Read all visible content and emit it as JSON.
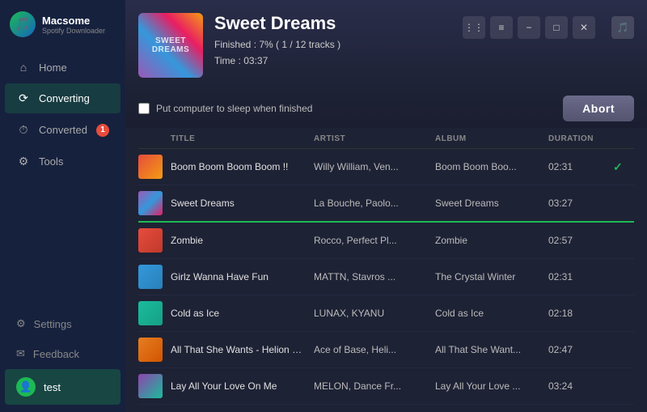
{
  "app": {
    "name": "Macsome",
    "subtitle": "Spotify Downloader",
    "logo_symbol": "🎵"
  },
  "sidebar": {
    "nav_items": [
      {
        "id": "home",
        "label": "Home",
        "icon": "⌂",
        "active": false,
        "badge": null
      },
      {
        "id": "converting",
        "label": "Converting",
        "icon": "⟳",
        "active": true,
        "badge": null
      },
      {
        "id": "converted",
        "label": "Converted",
        "icon": "⏱",
        "active": false,
        "badge": "1"
      },
      {
        "id": "tools",
        "label": "Tools",
        "icon": "⚙",
        "active": false,
        "badge": null
      }
    ],
    "settings_label": "Settings",
    "feedback_label": "Feedback",
    "feedback_icon": "✉",
    "user_label": "test"
  },
  "header": {
    "album_title": "Sweet Dreams",
    "progress_text": "Finished : 7% ( 1 / 12 tracks )",
    "time_text": "Time : 03:37",
    "sleep_label": "Put computer to sleep when finished",
    "abort_label": "Abort"
  },
  "table": {
    "columns": [
      "",
      "TITLE",
      "ARTIST",
      "ALBUM",
      "DURATION",
      ""
    ],
    "rows": [
      {
        "id": 1,
        "thumb_class": "thumb-1",
        "title": "Boom Boom Boom Boom !!",
        "artist": "Willy William, Ven...",
        "album": "Boom Boom Boo...",
        "duration": "02:31",
        "checked": true,
        "active": false
      },
      {
        "id": 2,
        "thumb_class": "thumb-2",
        "title": "Sweet Dreams",
        "artist": "La Bouche, Paolo...",
        "album": "Sweet Dreams",
        "duration": "03:27",
        "checked": false,
        "active": true
      },
      {
        "id": 3,
        "thumb_class": "thumb-3",
        "title": "Zombie",
        "artist": "Rocco, Perfect Pl...",
        "album": "Zombie",
        "duration": "02:57",
        "checked": false,
        "active": false
      },
      {
        "id": 4,
        "thumb_class": "thumb-4",
        "title": "Girlz Wanna Have Fun",
        "artist": "MATTN, Stavros ...",
        "album": "The Crystal Winter",
        "duration": "02:31",
        "checked": false,
        "active": false
      },
      {
        "id": 5,
        "thumb_class": "thumb-5",
        "title": "Cold as Ice",
        "artist": "LUNAX, KYANU",
        "album": "Cold as Ice",
        "duration": "02:18",
        "checked": false,
        "active": false
      },
      {
        "id": 6,
        "thumb_class": "thumb-6",
        "title": "All That She Wants - Helion Remix",
        "artist": "Ace of Base, Heli...",
        "album": "All That She Want...",
        "duration": "02:47",
        "checked": false,
        "active": false
      },
      {
        "id": 7,
        "thumb_class": "thumb-7",
        "title": "Lay All Your Love On Me",
        "artist": "MELON, Dance Fr...",
        "album": "Lay All Your Love ...",
        "duration": "03:24",
        "checked": false,
        "active": false
      }
    ]
  }
}
